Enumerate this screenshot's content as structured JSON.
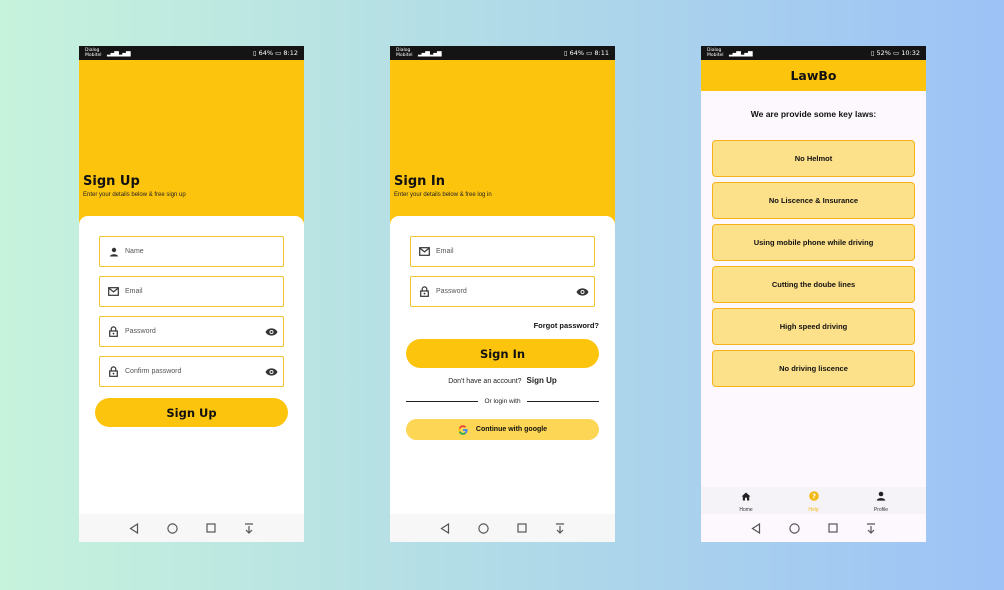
{
  "status_bars": {
    "signup": {
      "carrier": "Dialog Mobitel",
      "battery": "64%",
      "time": "8:12"
    },
    "signin": {
      "carrier": "Dialog Mobitel",
      "battery": "64%",
      "time": "8:11"
    },
    "help": {
      "carrier": "Dialog Mobitel",
      "battery": "52%",
      "time": "10:32"
    }
  },
  "signup": {
    "title": "Sign Up",
    "subtitle": "Enter your details below & free sign up",
    "fields": {
      "name": {
        "placeholder": "Name",
        "icon": "person-icon"
      },
      "email": {
        "placeholder": "Email",
        "icon": "mail-icon"
      },
      "password": {
        "placeholder": "Password",
        "icon": "lock-icon"
      },
      "confirm": {
        "placeholder": "Confirm password",
        "icon": "lock-icon"
      }
    },
    "button": "Sign Up"
  },
  "signin": {
    "title": "Sign In",
    "subtitle": "Enter your details below & free log in",
    "fields": {
      "email": {
        "placeholder": "Email",
        "icon": "mail-icon"
      },
      "password": {
        "placeholder": "Password",
        "icon": "lock-icon"
      }
    },
    "forgot": "Forgot password?",
    "button": "Sign In",
    "no_account": "Don't have an account?",
    "sign_up_link": "Sign Up",
    "divider": "Or login with",
    "google": "Continue with google"
  },
  "help": {
    "app_title": "LawBo",
    "heading": "We are provide some key laws:",
    "laws": [
      "No Helmot",
      "No Liscence & Insurance",
      "Using mobile phone while driving",
      "Cutting the doube lines",
      "High speed driving",
      "No driving liscence"
    ],
    "nav": {
      "home": "Home",
      "help": "Help",
      "profile": "Profile"
    }
  },
  "colors": {
    "accent": "#fdc40e",
    "law_fill": "#fde08a",
    "law_border": "#f6b318",
    "field_border": "#f3c230"
  }
}
